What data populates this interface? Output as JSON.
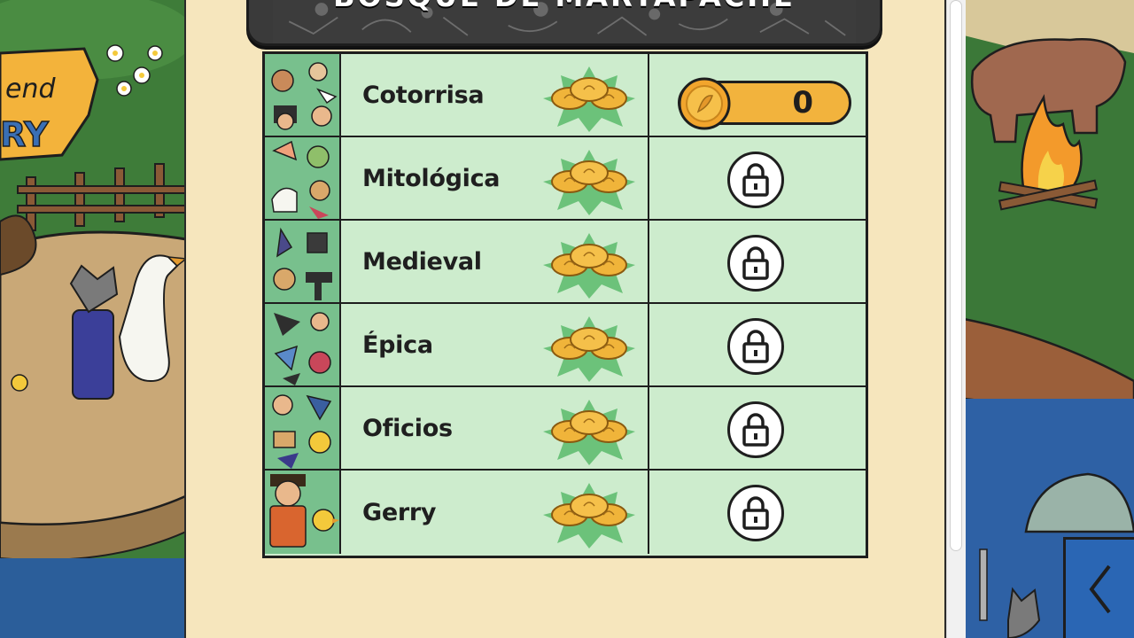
{
  "title": "BOSQUE DE MARTAPACHE",
  "sign_text": {
    "line1": "end",
    "line2": "RY"
  },
  "packs": [
    {
      "name": "Cotorrisa",
      "status": "coins",
      "coin_count": "0"
    },
    {
      "name": "Mitológica",
      "status": "locked"
    },
    {
      "name": "Medieval",
      "status": "locked"
    },
    {
      "name": "Épica",
      "status": "locked"
    },
    {
      "name": "Oficios",
      "status": "locked"
    },
    {
      "name": "Gerry",
      "status": "locked"
    }
  ],
  "icons": {
    "coin_badge": "coin-stack-icon",
    "lock": "padlock-icon",
    "coin": "coin-icon",
    "back": "chevron-left-icon"
  },
  "colors": {
    "panel": "#f6e6bd",
    "row": "#cdeccd",
    "coin": "#f2b33d",
    "banner": "#3a3a3a",
    "star": "#6cc27a"
  }
}
